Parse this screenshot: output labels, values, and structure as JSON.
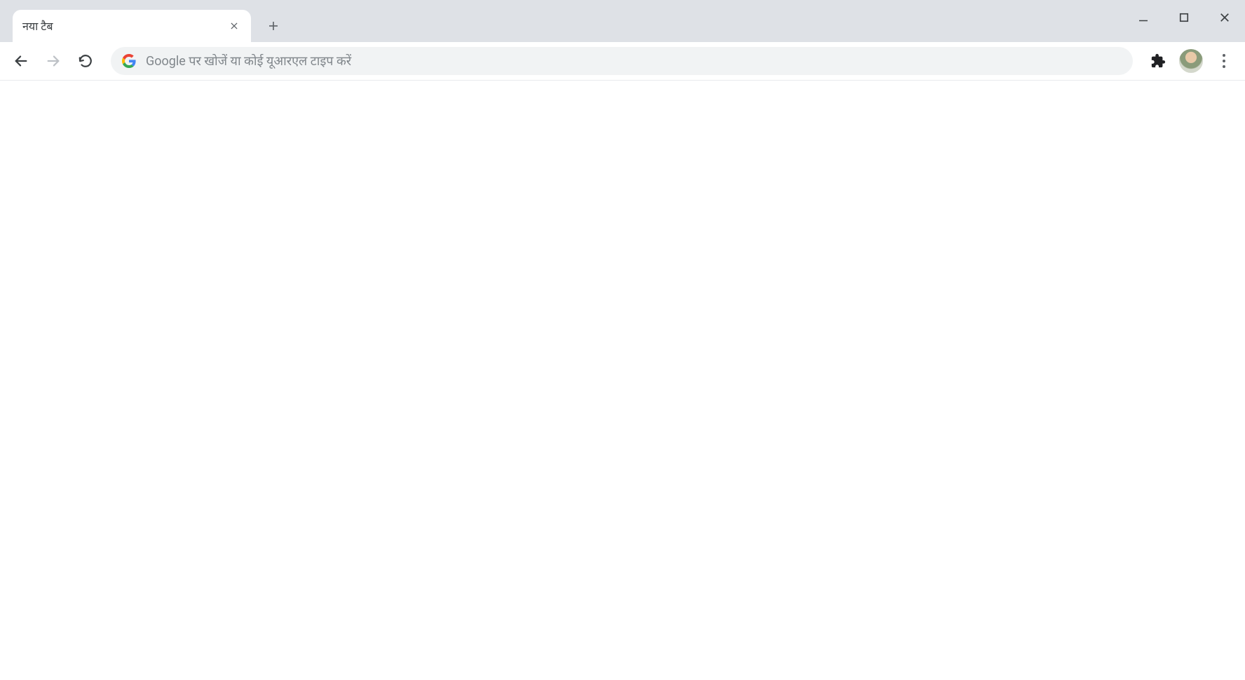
{
  "tab": {
    "title": "नया टैब"
  },
  "omnibox": {
    "placeholder": "Google पर खोजें या कोई यूआरएल टाइप करें",
    "value": ""
  }
}
